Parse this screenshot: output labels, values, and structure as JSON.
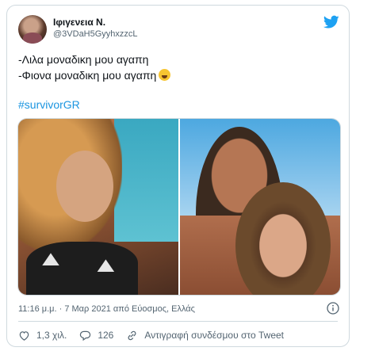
{
  "tweet": {
    "user_name": "Ιφιγενεια Ν.",
    "user_handle": "@3VDaH5GyyhxzzcL",
    "text_lines": [
      "-Λιλα μοναδικη μου αγαπη",
      "-Φιονα μοναδικη μου αγαπη"
    ],
    "hashtag": "#survivorGR",
    "timestamp": "11:16 μ.μ. · 7 Μαρ 2021 από Εύοσμος, Ελλάς"
  },
  "actions": {
    "like_count": "1,3 χιλ.",
    "reply_count": "126",
    "copy_link_label": "Αντιγραφή συνδέσμου στο Tweet"
  },
  "icons": {
    "brand": "twitter-bird-icon",
    "emoji": "rolling-on-floor-laughing-emoji",
    "like": "heart-icon",
    "reply": "comment-icon",
    "copy": "link-icon",
    "info": "info-icon"
  },
  "colors": {
    "accent": "#1da1f2",
    "hashtag": "#1b95e0",
    "secondary_text": "#536471",
    "border": "#cfd9de"
  }
}
